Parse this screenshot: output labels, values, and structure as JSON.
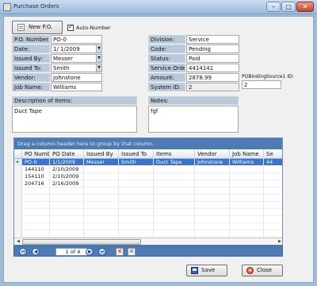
{
  "window": {
    "title": "Purchase Orders",
    "ghost_title": "",
    "controls": {
      "minimize": "–",
      "maximize": "□",
      "close": "✕"
    }
  },
  "toolbar": {
    "new_po_label": "New P.O.",
    "auto_number_label": "Auto-Number",
    "auto_number_checked": true
  },
  "left_fields": [
    {
      "label": "P.O. Number:",
      "value": "PO-0",
      "dropdown": false
    },
    {
      "label": "Date:",
      "value": "1/  1/2009",
      "dropdown": true
    },
    {
      "label": "Issued By:",
      "value": "Messer",
      "dropdown": true
    },
    {
      "label": "Issued To:",
      "value": "Smith",
      "dropdown": true
    },
    {
      "label": "Vendor:",
      "value": "Johnstone",
      "dropdown": false
    },
    {
      "label": "Job Name:",
      "value": "Williams",
      "dropdown": false
    }
  ],
  "right_fields": [
    {
      "label": "Division:",
      "value": "Service"
    },
    {
      "label": "Code:",
      "value": "Pending"
    },
    {
      "label": "Status:",
      "value": "Paid"
    },
    {
      "label": "Service Order:",
      "value": "4414141"
    },
    {
      "label": "Amount:",
      "value": "2878.99"
    },
    {
      "label": "System ID:",
      "value": "2"
    }
  ],
  "pobinding": {
    "label": "POBindingSource1 ID:",
    "value": "2"
  },
  "description": {
    "header": "Description of Items:",
    "value": "Duct Tape"
  },
  "notes": {
    "header": "Notes:",
    "value": "fgf"
  },
  "grid": {
    "group_panel_text": "Drag a column header here to group by that column.",
    "columns": [
      "PO Number",
      "PO Date",
      "Issued By",
      "Issued To",
      "Items",
      "Vendor",
      "Job Name",
      "Se"
    ],
    "rows": [
      [
        "PO-0",
        "1/1/2009",
        "Messer",
        "Smith",
        "Duct Tape",
        "Johnstone",
        "Williams",
        "44"
      ],
      [
        "144110",
        "2/10/2009",
        "",
        "",
        "",
        "",
        "",
        ""
      ],
      [
        "154110",
        "2/10/2009",
        "",
        "",
        "",
        "",
        "",
        ""
      ],
      [
        "204716",
        "2/16/2009",
        "",
        "",
        "",
        "",
        "",
        ""
      ]
    ],
    "selected_row": 0,
    "empty_rows": 7
  },
  "navigator": {
    "position_text": "1 of 4"
  },
  "actions": {
    "save_label": "Save",
    "close_label": "Close"
  },
  "colors": {
    "accent": "#4e7bb3",
    "selection": "#3b74c8",
    "label_bg": "#b9c9da"
  }
}
